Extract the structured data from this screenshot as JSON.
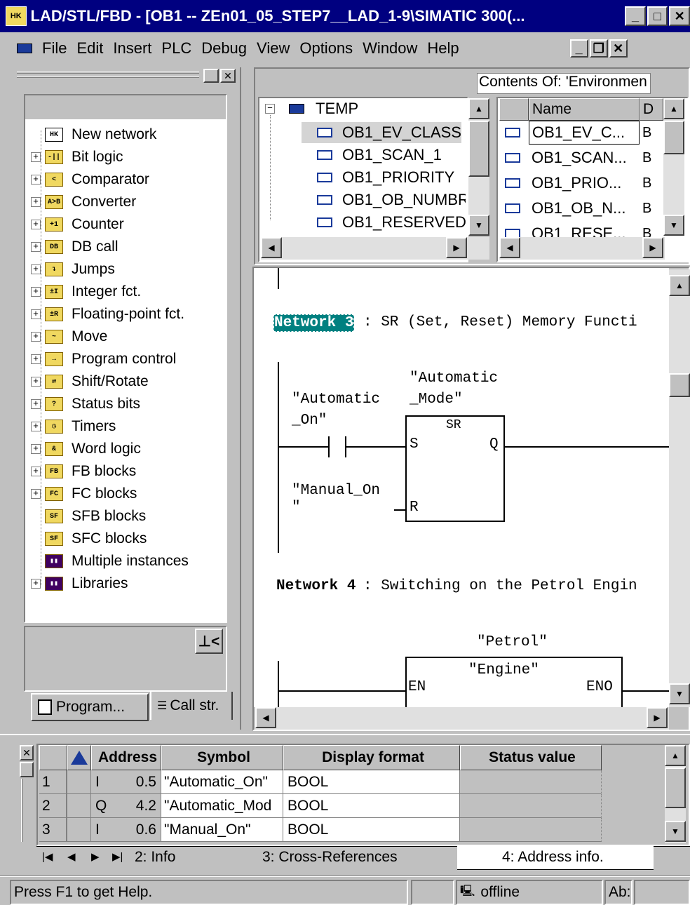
{
  "window": {
    "title": "LAD/STL/FBD  - [OB1 -- ZEn01_05_STEP7__LAD_1-9\\SIMATIC 300(...",
    "min": "_",
    "max": "□",
    "close": "✕"
  },
  "menu": [
    "File",
    "Edit",
    "Insert",
    "PLC",
    "Debug",
    "View",
    "Options",
    "Window",
    "Help"
  ],
  "catalog": {
    "items": [
      {
        "label": "New network",
        "expand": false,
        "icon": "new-network-icon",
        "glyph": "HK"
      },
      {
        "label": "Bit logic",
        "expand": true,
        "icon": "bit-logic-icon",
        "glyph": "-||"
      },
      {
        "label": "Comparator",
        "expand": true,
        "icon": "comparator-icon",
        "glyph": "<"
      },
      {
        "label": "Converter",
        "expand": true,
        "icon": "converter-icon",
        "glyph": "A>B"
      },
      {
        "label": "Counter",
        "expand": true,
        "icon": "counter-icon",
        "glyph": "+1"
      },
      {
        "label": "DB call",
        "expand": true,
        "icon": "db-call-icon",
        "glyph": "DB"
      },
      {
        "label": "Jumps",
        "expand": true,
        "icon": "jumps-icon",
        "glyph": "↴"
      },
      {
        "label": "Integer fct.",
        "expand": true,
        "icon": "integer-fct-icon",
        "glyph": "±I"
      },
      {
        "label": "Floating-point fct.",
        "expand": true,
        "icon": "floating-point-icon",
        "glyph": "±R"
      },
      {
        "label": "Move",
        "expand": true,
        "icon": "move-icon",
        "glyph": "~"
      },
      {
        "label": "Program control",
        "expand": true,
        "icon": "program-control-icon",
        "glyph": "→"
      },
      {
        "label": "Shift/Rotate",
        "expand": true,
        "icon": "shift-rotate-icon",
        "glyph": "⇄"
      },
      {
        "label": "Status bits",
        "expand": true,
        "icon": "status-bits-icon",
        "glyph": "?"
      },
      {
        "label": "Timers",
        "expand": true,
        "icon": "timers-icon",
        "glyph": "◷"
      },
      {
        "label": "Word logic",
        "expand": true,
        "icon": "word-logic-icon",
        "glyph": "&"
      },
      {
        "label": "FB blocks",
        "expand": true,
        "icon": "fb-blocks-icon",
        "glyph": "FB"
      },
      {
        "label": "FC blocks",
        "expand": true,
        "icon": "fc-blocks-icon",
        "glyph": "FC"
      },
      {
        "label": "SFB blocks",
        "expand": false,
        "icon": "sfb-blocks-icon",
        "glyph": "SF"
      },
      {
        "label": "SFC blocks",
        "expand": false,
        "icon": "sfc-blocks-icon",
        "glyph": "SF"
      },
      {
        "label": "Multiple instances",
        "expand": false,
        "icon": "multiple-instances-icon",
        "glyph": "▮▮"
      },
      {
        "label": "Libraries",
        "expand": true,
        "icon": "libraries-icon",
        "glyph": "▮▮"
      }
    ],
    "tabs": [
      "Program...",
      "Call str."
    ]
  },
  "temp_tree": {
    "root": "TEMP",
    "items": [
      "OB1_EV_CLASS",
      "OB1_SCAN_1",
      "OB1_PRIORITY",
      "OB1_OB_NUMBR",
      "OB1_RESERVED_"
    ]
  },
  "contents": {
    "header": "Contents Of: 'Environmen",
    "col_name": "Name",
    "col_d": "D",
    "rows": [
      {
        "name": "OB1_EV_C...",
        "d": "B"
      },
      {
        "name": "OB1_SCAN...",
        "d": "B"
      },
      {
        "name": "OB1_PRIO...",
        "d": "B"
      },
      {
        "name": "OB1_OB_N...",
        "d": "B"
      },
      {
        "name": "OB1_RESE...",
        "d": "B"
      }
    ]
  },
  "editor": {
    "net3_label": "Network 3",
    "net3_title": ": SR (Set, Reset) Memory Functi",
    "auto_on_1": "\"Automatic",
    "auto_on_2": "_On\"",
    "auto_mode_1": "\"Automatic",
    "auto_mode_2": "_Mode\"",
    "sr": "SR",
    "s": "S",
    "q": "Q",
    "r": "R",
    "manual_on_1": "\"Manual_On",
    "manual_on_2": "\"",
    "net4_label": "Network 4",
    "net4_title": ": Switching on the Petrol Engin",
    "petrol": "\"Petrol\"",
    "engine": "\"Engine\"",
    "en": "EN",
    "eno": "ENO"
  },
  "address_table": {
    "headers": [
      "Address",
      "Symbol",
      "Display format",
      "Status value"
    ],
    "rows": [
      {
        "n": "1",
        "type": "I",
        "addr": "0.5",
        "symbol": "\"Automatic_On\"",
        "format": "BOOL"
      },
      {
        "n": "2",
        "type": "Q",
        "addr": "4.2",
        "symbol": "\"Automatic_Mod",
        "format": "BOOL"
      },
      {
        "n": "3",
        "type": "I",
        "addr": "0.6",
        "symbol": "\"Manual_On\"",
        "format": "BOOL"
      }
    ],
    "tabs": [
      "2: Info",
      "3: Cross-References",
      "4: Address info."
    ]
  },
  "statusbar": {
    "help": "Press F1 to get Help.",
    "mode": "offline",
    "ins": "Ab:"
  }
}
